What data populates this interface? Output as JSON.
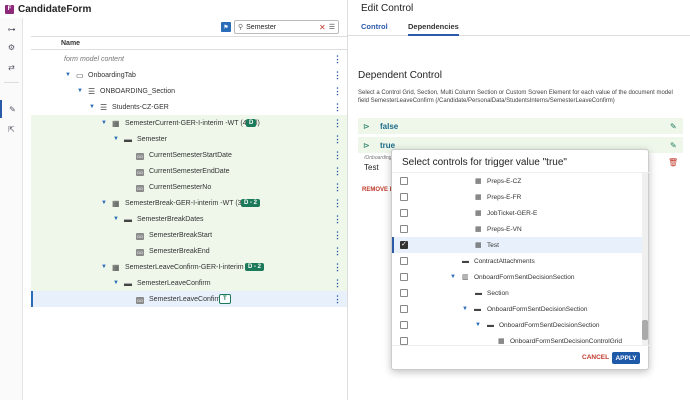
{
  "app": {
    "icon_letter": "F",
    "title": "CandidateForm"
  },
  "rail": {
    "items": [
      "tree-icon",
      "gear-icon",
      "arrows-icon",
      "pen-icon",
      "export-icon"
    ]
  },
  "search": {
    "value": "Semester"
  },
  "tree": {
    "column_header": "Name",
    "rows": [
      {
        "label": "form model content"
      },
      {
        "label": "OnboardingTab"
      },
      {
        "label": "ONBOARDING_Section"
      },
      {
        "label": "Students-CZ-GER"
      },
      {
        "label": "SemesterCurrent-GER-I-interim -WT (4 col)",
        "badge": "D"
      },
      {
        "label": "Semester"
      },
      {
        "label": "CurrentSemesterStartDate"
      },
      {
        "label": "CurrentSemesterEndDate"
      },
      {
        "label": "CurrentSemesterNo"
      },
      {
        "label": "SemesterBreak-GER-I-interim -WT (3 col)",
        "badge": "D - 2"
      },
      {
        "label": "SemesterBreakDates"
      },
      {
        "label": "SemesterBreakStart"
      },
      {
        "label": "SemesterBreakEnd"
      },
      {
        "label": "SemesterLeaveConfirm-GER-I-interim -WT",
        "badge": "D - 2"
      },
      {
        "label": "SemesterLeaveConfirm"
      },
      {
        "label": "SemesterLeaveConfirm",
        "badge": "T"
      }
    ]
  },
  "right": {
    "title": "Edit Control",
    "tabs": [
      "Control",
      "Dependencies"
    ],
    "dep_title": "Dependent Control",
    "dep_desc": "Select a Control Grid, Section, Multi Column Section or Custom Screen Element for each value of the document model field SemesterLeaveConfirm (/Candidate/PersonalData/StudentsInterns/SemesterLeaveConfirm)",
    "values": [
      "false",
      "true"
    ],
    "sub_label": "/Onboarding",
    "sub_value": "Test",
    "remove_label": "REMOVE D"
  },
  "modal": {
    "title": "Select controls for trigger value \"true\"",
    "items": [
      {
        "label": "Preps-E-CZ",
        "checked": false
      },
      {
        "label": "Preps-E-FR",
        "checked": false
      },
      {
        "label": "JobTicket-GER-E",
        "checked": false
      },
      {
        "label": "Preps-E-VN",
        "checked": false
      },
      {
        "label": "Test",
        "checked": true
      },
      {
        "label": "ContractAttachments",
        "checked": false
      },
      {
        "label": "OnboardFormSentDecisionSection",
        "checked": false
      },
      {
        "label": "Section",
        "checked": false
      },
      {
        "label": "OnboardFormSentDecisionSection",
        "checked": false
      },
      {
        "label": "OnboardFormSentDecisionSection",
        "checked": false
      },
      {
        "label": "OnboardFormSentDecisionControlGrid",
        "checked": false
      }
    ],
    "cancel_label": "CANCEL",
    "apply_label": "APPLY"
  }
}
